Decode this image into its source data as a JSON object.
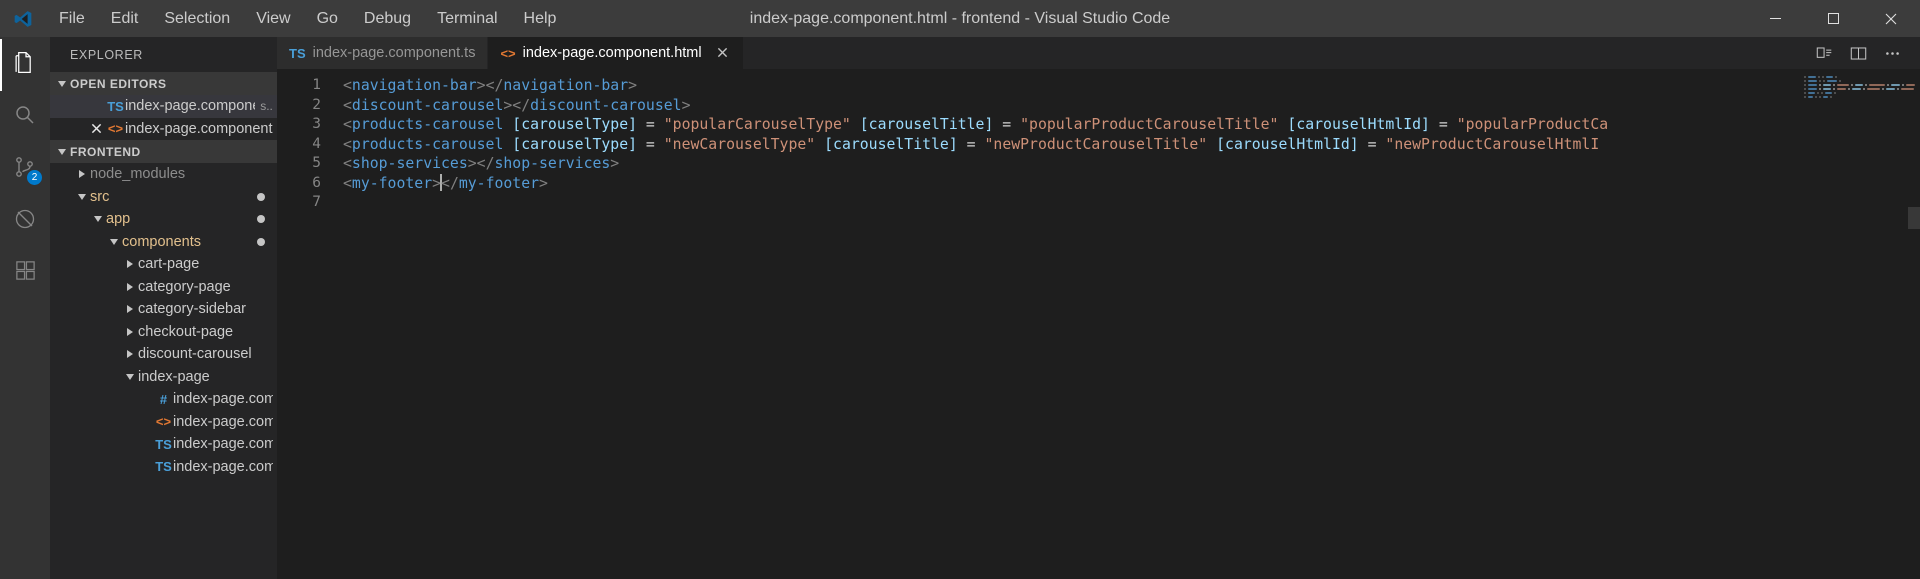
{
  "titlebar": {
    "logo_icon": "vscode-logo-icon",
    "menus": [
      "File",
      "Edit",
      "Selection",
      "View",
      "Go",
      "Debug",
      "Terminal",
      "Help"
    ],
    "window_title": "index-page.component.html - frontend - Visual Studio Code",
    "controls": {
      "minimize": "minimize-icon",
      "maximize": "maximize-icon",
      "close": "close-icon"
    }
  },
  "activitybar": {
    "items": [
      {
        "name": "explorer",
        "icon": "files-icon",
        "active": true,
        "badge": ""
      },
      {
        "name": "search",
        "icon": "search-icon",
        "active": false,
        "badge": ""
      },
      {
        "name": "source-control",
        "icon": "source-control-icon",
        "active": false,
        "badge": "2"
      },
      {
        "name": "debug",
        "icon": "debug-icon",
        "active": false,
        "badge": ""
      },
      {
        "name": "extensions",
        "icon": "extensions-icon",
        "active": false,
        "badge": ""
      }
    ]
  },
  "sidebar": {
    "title": "EXPLORER",
    "open_editors": {
      "header": "OPEN EDITORS",
      "items": [
        {
          "icon": "ts-file-icon",
          "label": "index-page.component.ts",
          "suffix": "s...",
          "selected": true,
          "dirty": false,
          "show_close": false
        },
        {
          "icon": "html-file-icon",
          "label": "index-page.component.ht...",
          "suffix": "",
          "selected": false,
          "dirty": false,
          "show_close": true
        }
      ]
    },
    "workspace": {
      "header": "FRONTEND",
      "tree": [
        {
          "label": "node_modules",
          "depth": 1,
          "type": "folder",
          "expanded": false,
          "color": "grey",
          "dot": false
        },
        {
          "label": "src",
          "depth": 1,
          "type": "folder",
          "expanded": true,
          "color": "orange",
          "dot": true
        },
        {
          "label": "app",
          "depth": 2,
          "type": "folder",
          "expanded": true,
          "color": "orange",
          "dot": true
        },
        {
          "label": "components",
          "depth": 3,
          "type": "folder",
          "expanded": true,
          "color": "orange",
          "dot": true
        },
        {
          "label": "cart-page",
          "depth": 4,
          "type": "folder",
          "expanded": false,
          "color": "normal",
          "dot": false
        },
        {
          "label": "category-page",
          "depth": 4,
          "type": "folder",
          "expanded": false,
          "color": "normal",
          "dot": false
        },
        {
          "label": "category-sidebar",
          "depth": 4,
          "type": "folder",
          "expanded": false,
          "color": "normal",
          "dot": false
        },
        {
          "label": "checkout-page",
          "depth": 4,
          "type": "folder",
          "expanded": false,
          "color": "normal",
          "dot": false
        },
        {
          "label": "discount-carousel",
          "depth": 4,
          "type": "folder",
          "expanded": false,
          "color": "normal",
          "dot": false
        },
        {
          "label": "index-page",
          "depth": 4,
          "type": "folder",
          "expanded": true,
          "color": "normal",
          "dot": false
        },
        {
          "label": "index-page.componen...",
          "depth": 5,
          "type": "file",
          "icon": "css-file-icon",
          "color": "normal",
          "dot": false
        },
        {
          "label": "index-page.componen...",
          "depth": 5,
          "type": "file",
          "icon": "html-file-icon",
          "color": "normal",
          "dot": false
        },
        {
          "label": "index-page.componen...",
          "depth": 5,
          "type": "file",
          "icon": "ts-file-icon",
          "color": "normal",
          "dot": false
        },
        {
          "label": "index-page.componen...",
          "depth": 5,
          "type": "file",
          "icon": "ts-file-icon",
          "color": "normal",
          "dot": false
        }
      ]
    }
  },
  "tabs": {
    "items": [
      {
        "icon": "ts-file-icon",
        "label": "index-page.component.ts",
        "active": false,
        "closable": false
      },
      {
        "icon": "html-file-icon",
        "label": "index-page.component.html",
        "active": true,
        "closable": true
      }
    ],
    "actions": [
      "split-editor-icon",
      "open-changes-icon",
      "more-actions-icon"
    ]
  },
  "editor": {
    "line_numbers": [
      "1",
      "2",
      "3",
      "4",
      "5",
      "6",
      "7"
    ],
    "lines": [
      [
        {
          "t": "<",
          "c": "brk"
        },
        {
          "t": "navigation-bar",
          "c": "tag"
        },
        {
          "t": ">",
          "c": "brk"
        },
        {
          "t": "</",
          "c": "brk"
        },
        {
          "t": "navigation-bar",
          "c": "tag"
        },
        {
          "t": ">",
          "c": "brk"
        }
      ],
      [
        {
          "t": "<",
          "c": "brk"
        },
        {
          "t": "discount-carousel",
          "c": "tag"
        },
        {
          "t": ">",
          "c": "brk"
        },
        {
          "t": "</",
          "c": "brk"
        },
        {
          "t": "discount-carousel",
          "c": "tag"
        },
        {
          "t": ">",
          "c": "brk"
        }
      ],
      [
        {
          "t": "<",
          "c": "brk"
        },
        {
          "t": "products-carousel",
          "c": "tag"
        },
        {
          "t": " ",
          "c": "op"
        },
        {
          "t": "[carouselType]",
          "c": "attr"
        },
        {
          "t": " = ",
          "c": "op"
        },
        {
          "t": "\"popularCarouselType\"",
          "c": "str"
        },
        {
          "t": " ",
          "c": "op"
        },
        {
          "t": "[carouselTitle]",
          "c": "attr"
        },
        {
          "t": " = ",
          "c": "op"
        },
        {
          "t": "\"popularProductCarouselTitle\"",
          "c": "str"
        },
        {
          "t": " ",
          "c": "op"
        },
        {
          "t": "[carouselHtmlId]",
          "c": "attr"
        },
        {
          "t": " = ",
          "c": "op"
        },
        {
          "t": "\"popularProductCa",
          "c": "str"
        }
      ],
      [
        {
          "t": "<",
          "c": "brk"
        },
        {
          "t": "products-carousel",
          "c": "tag"
        },
        {
          "t": " ",
          "c": "op"
        },
        {
          "t": "[carouselType]",
          "c": "attr"
        },
        {
          "t": " = ",
          "c": "op"
        },
        {
          "t": "\"newCarouselType\"",
          "c": "str"
        },
        {
          "t": " ",
          "c": "op"
        },
        {
          "t": "[carouselTitle]",
          "c": "attr"
        },
        {
          "t": " = ",
          "c": "op"
        },
        {
          "t": "\"newProductCarouselTitle\"",
          "c": "str"
        },
        {
          "t": " ",
          "c": "op"
        },
        {
          "t": "[carouselHtmlId]",
          "c": "attr"
        },
        {
          "t": " = ",
          "c": "op"
        },
        {
          "t": "\"newProductCarouselHtmlI",
          "c": "str"
        }
      ],
      [
        {
          "t": "<",
          "c": "brk"
        },
        {
          "t": "shop-services",
          "c": "tag"
        },
        {
          "t": ">",
          "c": "brk"
        },
        {
          "t": "</",
          "c": "brk"
        },
        {
          "t": "shop-services",
          "c": "tag"
        },
        {
          "t": ">",
          "c": "brk"
        }
      ],
      [
        {
          "t": "<",
          "c": "brk"
        },
        {
          "t": "my-footer",
          "c": "tag"
        },
        {
          "t": ">",
          "c": "brk"
        },
        {
          "t": "CURSOR",
          "c": "cursor"
        },
        {
          "t": "</",
          "c": "brk"
        },
        {
          "t": "my-footer",
          "c": "tag"
        },
        {
          "t": ">",
          "c": "brk"
        }
      ],
      []
    ]
  },
  "colors": {
    "accent": "#007acc",
    "tag": "#569cd6",
    "attribute": "#9cdcfe",
    "string": "#ce9178",
    "editor_bg": "#1e1e1e",
    "sidebar_bg": "#252526",
    "titlebar_bg": "#3c3c3c",
    "folder_modified": "#e2c08d"
  }
}
